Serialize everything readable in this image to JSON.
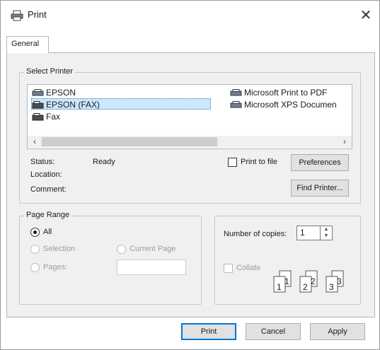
{
  "window": {
    "title": "Print",
    "close_glyph": "✕"
  },
  "tabs": [
    {
      "label": "General"
    }
  ],
  "select_printer": {
    "group_title": "Select Printer",
    "printers": [
      {
        "name": "EPSON",
        "icon": "printer-icon"
      },
      {
        "name": "Microsoft Print to PDF",
        "icon": "printer-icon"
      },
      {
        "name": "EPSON (FAX)",
        "icon": "fax-icon",
        "selected": true
      },
      {
        "name": "Microsoft XPS Documen",
        "icon": "printer-icon"
      },
      {
        "name": "Fax",
        "icon": "fax-icon"
      }
    ],
    "status_label": "Status:",
    "status_value": "Ready",
    "location_label": "Location:",
    "comment_label": "Comment:",
    "print_to_file_label": "Print to file",
    "preferences_label": "Preferences",
    "find_printer_label": "Find Printer..."
  },
  "page_range": {
    "group_title": "Page Range",
    "all_label": "All",
    "selection_label": "Selection",
    "current_page_label": "Current Page",
    "pages_label": "Pages:",
    "pages_value": ""
  },
  "copies": {
    "number_label": "Number of copies:",
    "number_value": "1",
    "collate_label": "Collate",
    "collate_sheets": [
      "1",
      "1",
      "2",
      "2",
      "3",
      "3"
    ]
  },
  "buttons": {
    "print_label": "Print",
    "cancel_label": "Cancel",
    "apply_label": "Apply"
  },
  "colors": {
    "selection": "#cce8ff",
    "panel": "#f0f0f0",
    "accent": "#0078d7"
  }
}
